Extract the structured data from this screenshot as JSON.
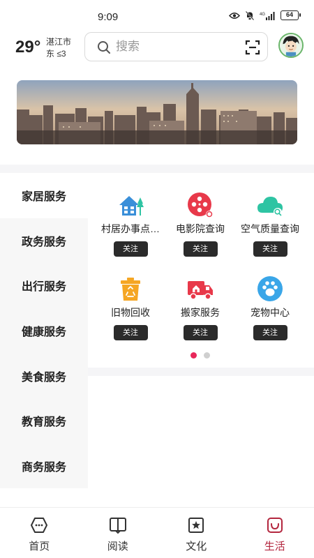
{
  "status_bar": {
    "time": "9:09",
    "network": "4G",
    "battery": "64"
  },
  "header": {
    "temperature": "29°",
    "city": "湛江市",
    "wind": "东 ≤3",
    "search_placeholder": "搜索"
  },
  "categories": [
    {
      "label": "家居服务",
      "active": true
    },
    {
      "label": "政务服务",
      "active": false
    },
    {
      "label": "出行服务",
      "active": false
    },
    {
      "label": "健康服务",
      "active": false
    },
    {
      "label": "美食服务",
      "active": false
    },
    {
      "label": "教育服务",
      "active": false
    },
    {
      "label": "商务服务",
      "active": false
    }
  ],
  "services": [
    {
      "label": "村居办事点…",
      "button": "关注",
      "icon": "house-tree-icon",
      "color": "#3a8fd9"
    },
    {
      "label": "电影院查询",
      "button": "关注",
      "icon": "film-reel-icon",
      "color": "#e8394a"
    },
    {
      "label": "空气质量查询",
      "button": "关注",
      "icon": "cloud-search-icon",
      "color": "#2ec4a3"
    },
    {
      "label": "旧物回收",
      "button": "关注",
      "icon": "recycle-bin-icon",
      "color": "#f5a623"
    },
    {
      "label": "搬家服务",
      "button": "关注",
      "icon": "moving-truck-icon",
      "color": "#e8394a"
    },
    {
      "label": "宠物中心",
      "button": "关注",
      "icon": "paw-icon",
      "color": "#3aa6e8"
    }
  ],
  "pagination": {
    "total": 2,
    "current": 1
  },
  "bottom_nav": [
    {
      "label": "首页",
      "icon": "home-icon",
      "active": false
    },
    {
      "label": "阅读",
      "icon": "book-icon",
      "active": false
    },
    {
      "label": "文化",
      "icon": "culture-icon",
      "active": false
    },
    {
      "label": "生活",
      "icon": "life-bag-icon",
      "active": true
    }
  ],
  "colors": {
    "accent": "#b3263e",
    "dot_active": "#e8275a",
    "button_bg": "#2b2b2b"
  }
}
